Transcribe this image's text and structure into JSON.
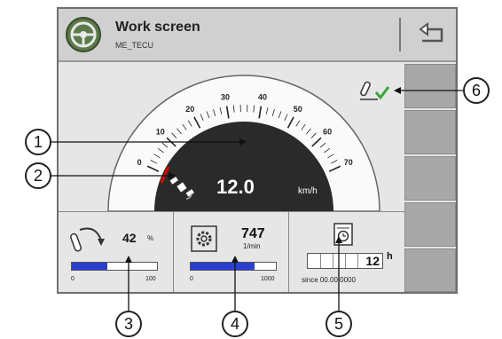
{
  "header": {
    "title": "Work screen",
    "subtitle": "ME_TECU"
  },
  "speedometer": {
    "ticks": [
      "0",
      "10",
      "20",
      "30",
      "40",
      "50",
      "60",
      "70"
    ],
    "value": "12.0",
    "unit": "km/h"
  },
  "panels": {
    "lift": {
      "value": "42",
      "unit": "%",
      "scale_min": "0",
      "scale_max": "100",
      "fill_fraction": 0.42
    },
    "pto": {
      "value": "747",
      "unit": "1/min",
      "scale_min": "0",
      "scale_max": "1000",
      "fill_fraction": 0.75
    },
    "hours": {
      "value": "12",
      "unit": "h",
      "since": "since 00.00.0000"
    }
  },
  "callouts": [
    "1",
    "2",
    "3",
    "4",
    "5",
    "6"
  ],
  "colors": {
    "bar_fill": "#2a3fd0",
    "needle": "#e00000",
    "check": "#3aa63a"
  },
  "icons": [
    "steering-wheel-icon",
    "back-arrow-icon",
    "implement-check-icon",
    "gps-satellite-icon",
    "hitch-lift-icon",
    "pto-gear-icon",
    "hour-counter-icon"
  ]
}
